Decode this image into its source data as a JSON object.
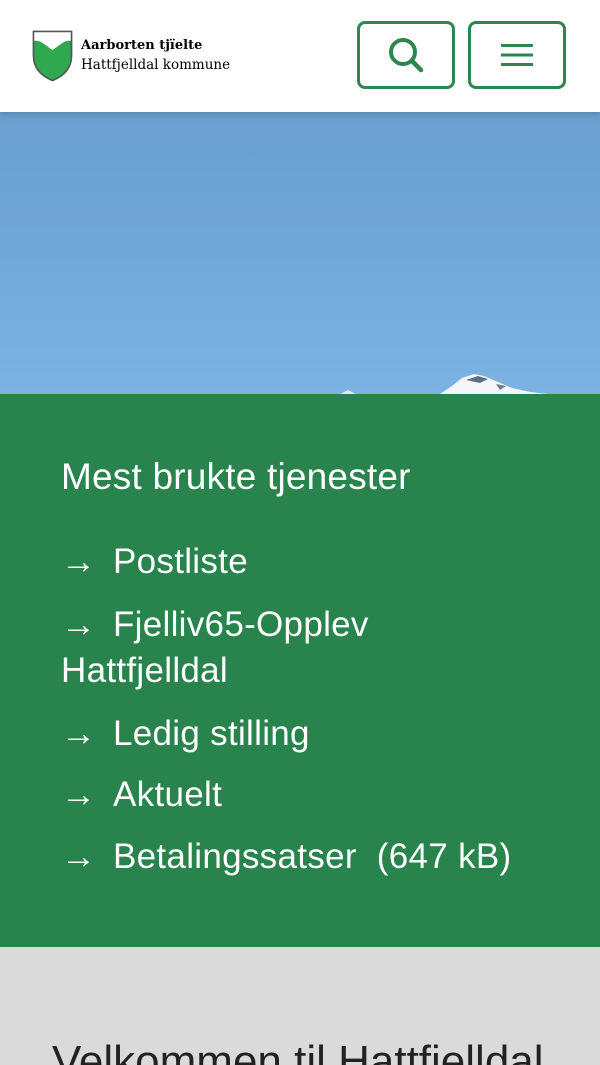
{
  "header": {
    "brand_line1": "Aarborten tjïelte",
    "brand_line2": "Hattfjelldal kommune",
    "search_icon": "search-icon",
    "menu_icon": "hamburger-menu-icon",
    "accent_color": "#2f8550"
  },
  "most_used": {
    "title": "Mest brukte tjenester",
    "arrow": "→",
    "links": [
      {
        "label": "Postliste"
      },
      {
        "label": "Fjelliv65-Opplev Hattfjelldal"
      },
      {
        "label": "Ledig stilling"
      },
      {
        "label": "Aktuelt"
      },
      {
        "label": "Betalingssatser",
        "size": "(647 kB)"
      }
    ],
    "background_color": "#28834d"
  },
  "welcome": {
    "title": "Velkommen til Hattfjelldal"
  }
}
